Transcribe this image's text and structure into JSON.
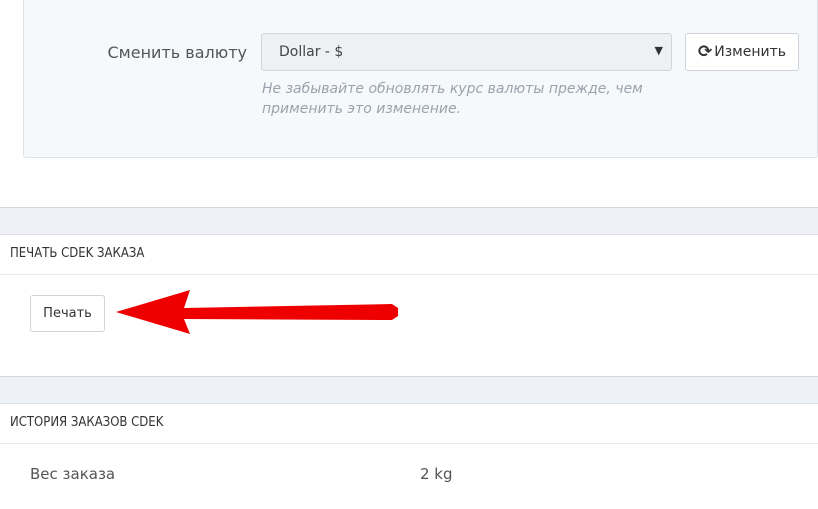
{
  "currency": {
    "label": "Сменить валюту",
    "selected": "Dollar - $",
    "help": "Не забывайте обновлять курс валюты прежде, чем применить это изменение.",
    "change_button": "Изменить"
  },
  "print_panel": {
    "title": "ПЕЧАТЬ CDEK ЗАКАЗА",
    "print_button": "Печать"
  },
  "history_panel": {
    "title": "ИСТОРИЯ ЗАКАЗОВ CDEK",
    "rows": [
      {
        "label": "Вес заказа",
        "value": "2 kg"
      }
    ]
  },
  "colors": {
    "annotation_arrow": "#ee0000",
    "page_background": "#eef1f5",
    "well_background": "#f6f9fb"
  },
  "icons": {
    "refresh": "refresh-icon",
    "select_caret": "caret-down-icon"
  }
}
